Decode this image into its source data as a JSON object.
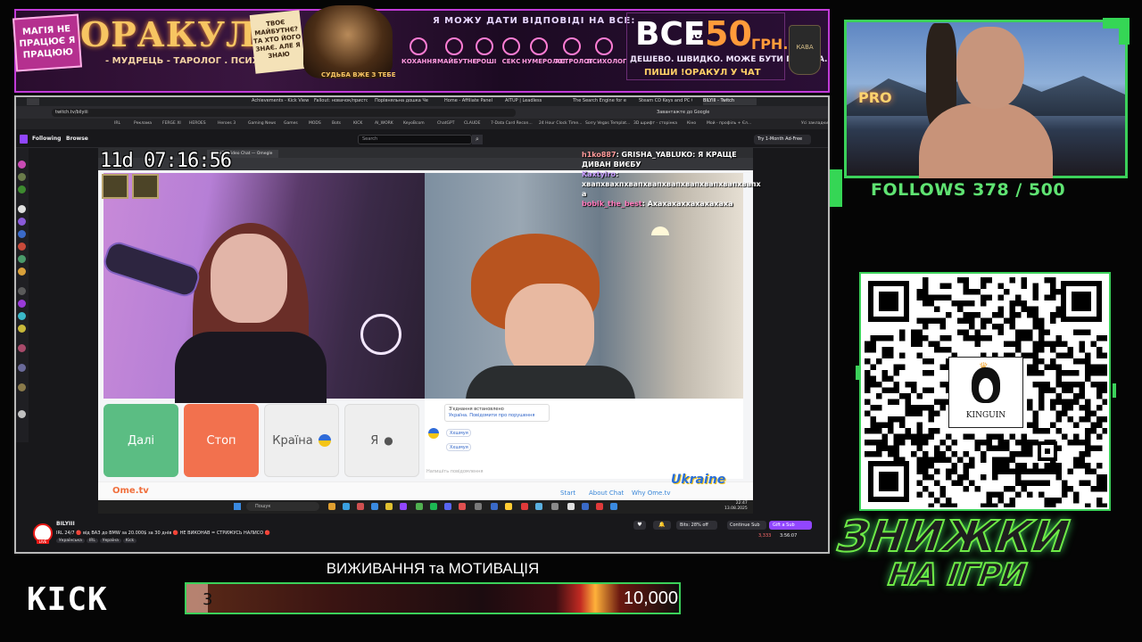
{
  "banner": {
    "left_badge": "МАГІЯ НЕ ПРАЦЮЄ Я ПРАЦЮЮ",
    "title": "ОРАКУЛ",
    "subtitle": "- МУДРЕЦЬ - ТАРОЛОГ . ПСИХОЛОГ -",
    "note": "ТВОЄ МАЙБУТНЄ? ТА ХТО ЙОГО ЗНАЄ. АЛЕ Я ЗНАЮ",
    "wizard_label": "СУДЬБА ВЖЕ З ТЕБЕ",
    "question": "Я МОЖУ ДАТИ ВІДПОВІДІ НА ВСЕ:",
    "categories": [
      "КОХАННЯ",
      "МАЙБУТНЄ",
      "ГРОШІ",
      "СЕКС",
      "НУМЕРОЛОГ",
      "АСТРОЛОГ",
      "ПСИХОЛОГ"
    ],
    "price_prefix": "ВСЕ",
    "price_po": "по",
    "price_value": "50",
    "price_currency": "ГРН.",
    "line1": "ДЕШЕВО. ШВИДКО. МОЖЕ БУТИ ПРАВДА.",
    "line2": "ПИШИ !ОРАКУЛ У ЧАТ",
    "cup_label": "КАВА"
  },
  "browser": {
    "tabs": [
      "Achievements - Kick Viewer",
      "Fallout: новачок/пристосов",
      "Порівняльна дошка Чемп",
      "Home - Affiliate Panel",
      "AITUP | Leadless",
      "The Search Engine for er...",
      "Steam CD Keys and PC Games",
      "BILYIII - Twitch"
    ],
    "url": "twitch.tv/bilyiii",
    "search_label": "Завантажте до Google",
    "bookmarks": [
      "IRL",
      "Реклама",
      "FERGE XI",
      "HEROES",
      "Heroes 3",
      "Gaming News",
      "Games",
      "MODS",
      "Bots",
      "KICK",
      "AI_WORK",
      "KeyoBcom",
      "ChatGPT",
      "CLAUDE",
      "7-Data Card Recon...",
      "24 Hour Clock Time...",
      "Sorry Vegas Templat...",
      "3D шрифт - сторінка",
      "Кіно",
      "Мой - профіль + Єл...",
      "Усі закладки"
    ]
  },
  "twitch": {
    "nav_following": "Following",
    "nav_browse": "Browse",
    "search_placeholder": "Search",
    "adfree": "Try 1-Month Ad-Free",
    "streamer": "BILYIII",
    "title": "IRL 24/7 🔴 від ВАЗ до BMW за 20.000$ за 30 днів 🔴 НЕ ВИКОНАВ = СТРИЖУСЬ НАЛИСО 🔴",
    "tags": [
      "Українська",
      "IRL",
      "Україна",
      "Kick"
    ],
    "live": "LIVE",
    "bits": "Bits: 28% off",
    "continue_sub": "Continue Sub",
    "gift_sub": "Gift a Sub",
    "viewers": "3,333",
    "uptime": "3:56:07"
  },
  "ome": {
    "tab_title": "OmeTV Video Chat — Omegle",
    "timer": "11d 07:16:56",
    "chat": [
      {
        "user": "h1ko887",
        "text": "GRISHA_YABLUKO: Я КРАЩЕ ДИВАН ВИЄБУ"
      },
      {
        "user": "Kaxtyiro",
        "text": "хвапхвахпхвапхвапхвапхвапхвапхвапхвапх а"
      },
      {
        "user": "bobik_the_best",
        "text": "Ахахахаххахахахаха"
      }
    ],
    "btn_next": "Далі",
    "btn_stop": "Стоп",
    "btn_country": "Країна",
    "btn_me": "Я",
    "conn_title": "З'єднання встановлено",
    "conn_text": "Україна. Повідомити про порушення",
    "messages": [
      "Ххшмуя",
      "Ххшмуя"
    ],
    "input_placeholder": "Напишіть повідомлення",
    "logo": "Ome.tv",
    "links": [
      "Start",
      "About Chat",
      "Why Ome.tv"
    ],
    "ukraine": "Ukraine",
    "taskbar_search": "Пошук",
    "taskbar_time": "22:47",
    "taskbar_date": "13.08.2025"
  },
  "overlay": {
    "follows": "FOLLOWS 378 / 500",
    "kinguin": "KINGUIN",
    "discount_line1": "ЗНИЖКИ",
    "discount_line2": "НА ІГРИ",
    "kick": "KICK",
    "goal_title": "ВИЖИВАННЯ та МОТИВАЦІЯ",
    "goal_current": "3",
    "goal_target": "10,000",
    "goal_fraction": 0.0003,
    "neon": "PRO"
  },
  "colors": {
    "accent_green": "#3bd15a",
    "twitch_purple": "#9146ff",
    "ome_next": "#5bbd83",
    "ome_stop": "#f2714e"
  }
}
